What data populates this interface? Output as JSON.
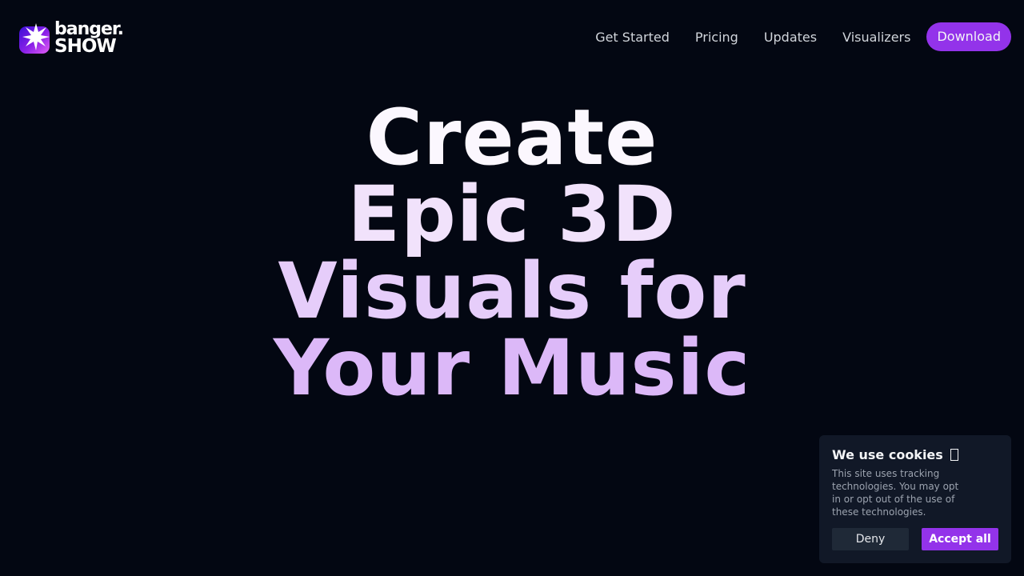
{
  "header": {
    "logo": {
      "line1": "banger.",
      "line2": "SHOW",
      "icon": "starburst-logo-icon"
    },
    "nav": [
      {
        "label": "Get Started"
      },
      {
        "label": "Pricing"
      },
      {
        "label": "Updates"
      },
      {
        "label": "Visualizers"
      }
    ],
    "download_label": "Download"
  },
  "hero": {
    "lines": [
      "Create",
      "Epic 3D",
      "Visuals for",
      "Your Music"
    ]
  },
  "cookie": {
    "title": "We use cookies",
    "title_icon": "cookie-icon",
    "text": "This site uses tracking technologies. You may opt in or opt out of the use of these technologies.",
    "deny_label": "Deny",
    "accept_label": "Accept all"
  },
  "colors": {
    "background": "#030712",
    "accent": "#9333ea",
    "panel": "#111827"
  }
}
